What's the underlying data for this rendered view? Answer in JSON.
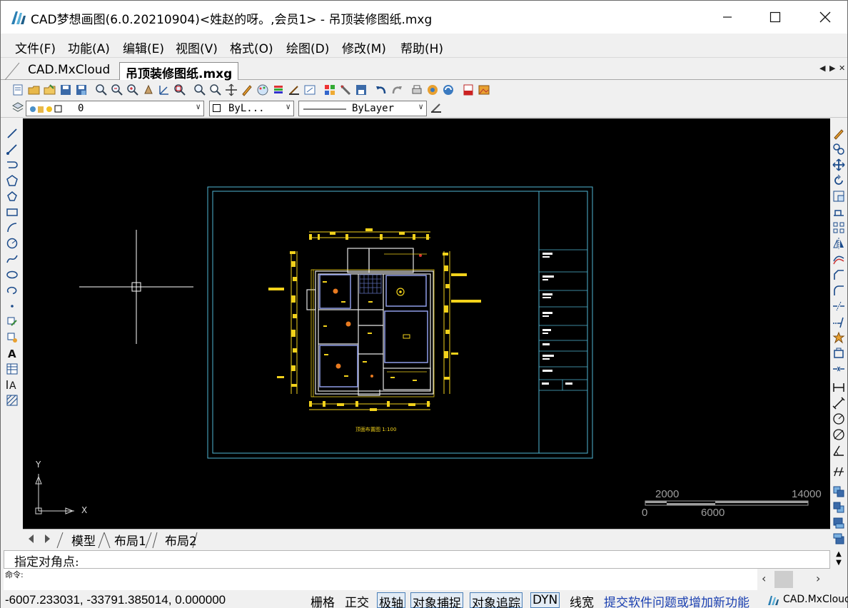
{
  "window": {
    "title": "CAD梦想画图(6.0.20210904)<姓赵的呀。,会员1> - 吊顶装修图纸.mxg",
    "minimize": "—",
    "maximize": "☐",
    "close": "✕"
  },
  "menu": [
    {
      "label": "文件(F)"
    },
    {
      "label": "功能(A)"
    },
    {
      "label": "编辑(E)"
    },
    {
      "label": "视图(V)"
    },
    {
      "label": "格式(O)"
    },
    {
      "label": "绘图(D)"
    },
    {
      "label": "修改(M)"
    },
    {
      "label": "帮助(H)"
    }
  ],
  "tabs": [
    {
      "label": "CAD.MxCloud",
      "active": false
    },
    {
      "label": "吊顶装修图纸.mxg",
      "active": true
    }
  ],
  "tab_nav": {
    "prev": "◀",
    "next": "▶",
    "close": "✕"
  },
  "properties_bar": {
    "layer_value": "0",
    "color_value": "ByL...",
    "linetype_value": "ByLayer"
  },
  "drawing": {
    "plan_title": "顶面布置图 1:100",
    "scale_bar": {
      "labels_top": [
        "2000",
        "14000"
      ],
      "labels_bottom": [
        "0",
        "6000"
      ]
    },
    "ucs": {
      "x": "X",
      "y": "Y"
    }
  },
  "layout_tabs": [
    {
      "label": "模型",
      "active": true
    },
    {
      "label": "布局1",
      "active": false
    },
    {
      "label": "布局2",
      "active": false
    }
  ],
  "command": {
    "prompt": "指定对角点:",
    "history": "命令:",
    "scroll_up": "▲",
    "scroll_down": "▼"
  },
  "status": {
    "coords": "-6007.233031,  -33791.385014,  0.000000",
    "toggles": [
      {
        "label": "栅格",
        "on": false
      },
      {
        "label": "正交",
        "on": false
      },
      {
        "label": "极轴",
        "on": true
      },
      {
        "label": "对象捕捉",
        "on": true
      },
      {
        "label": "对象追踪",
        "on": true
      },
      {
        "label": "DYN",
        "on": true
      },
      {
        "label": "线宽",
        "on": false
      }
    ],
    "feedback_link": "提交软件问题或增加新功能",
    "brand": "CAD.MxCloud"
  },
  "colors": {
    "canvas": "#000000",
    "frame": "#4fb6d3",
    "plan_yellow": "#f2d21b",
    "plan_white": "#e6e6e6",
    "room_blue": "#8f9ee8",
    "link": "#1a3fb0"
  }
}
